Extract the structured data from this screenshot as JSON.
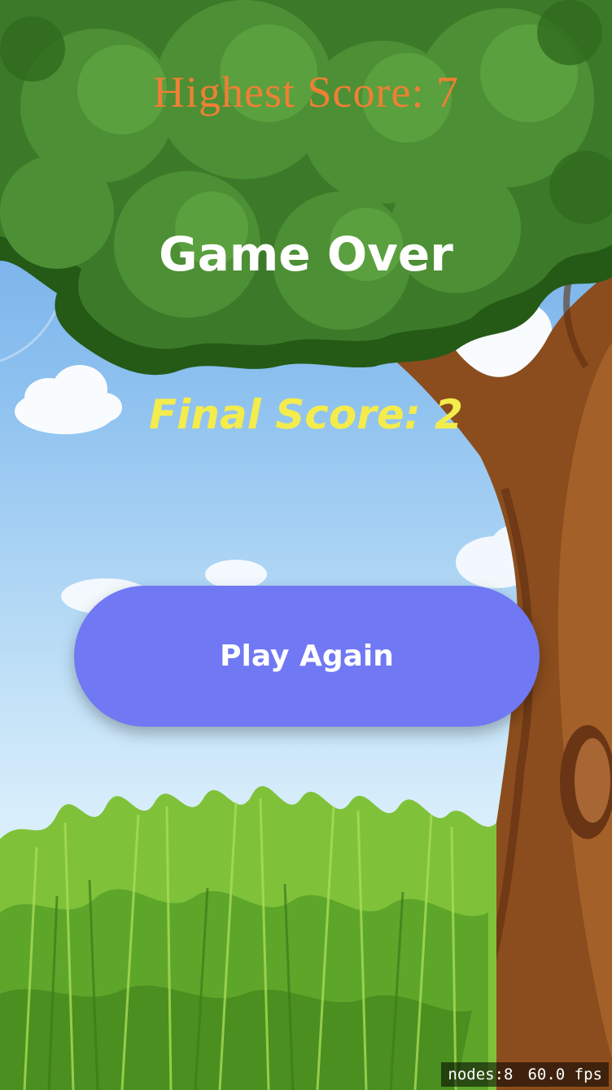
{
  "hud": {
    "highest_score": "Highest Score: 7",
    "title": "Game Over",
    "final_score": "Final Score: 2"
  },
  "play_again": {
    "label": "Play Again"
  },
  "debug": {
    "nodes": "nodes:8",
    "fps": "60.0 fps"
  },
  "colors": {
    "highest_score": "#ef7f35",
    "final_score": "#f3ec4c",
    "button": "#7078f4",
    "sky": "#8cc0ef",
    "leaves": "#3c7a2a",
    "trunk": "#8b4d1d",
    "grass": "#7fc23a"
  }
}
